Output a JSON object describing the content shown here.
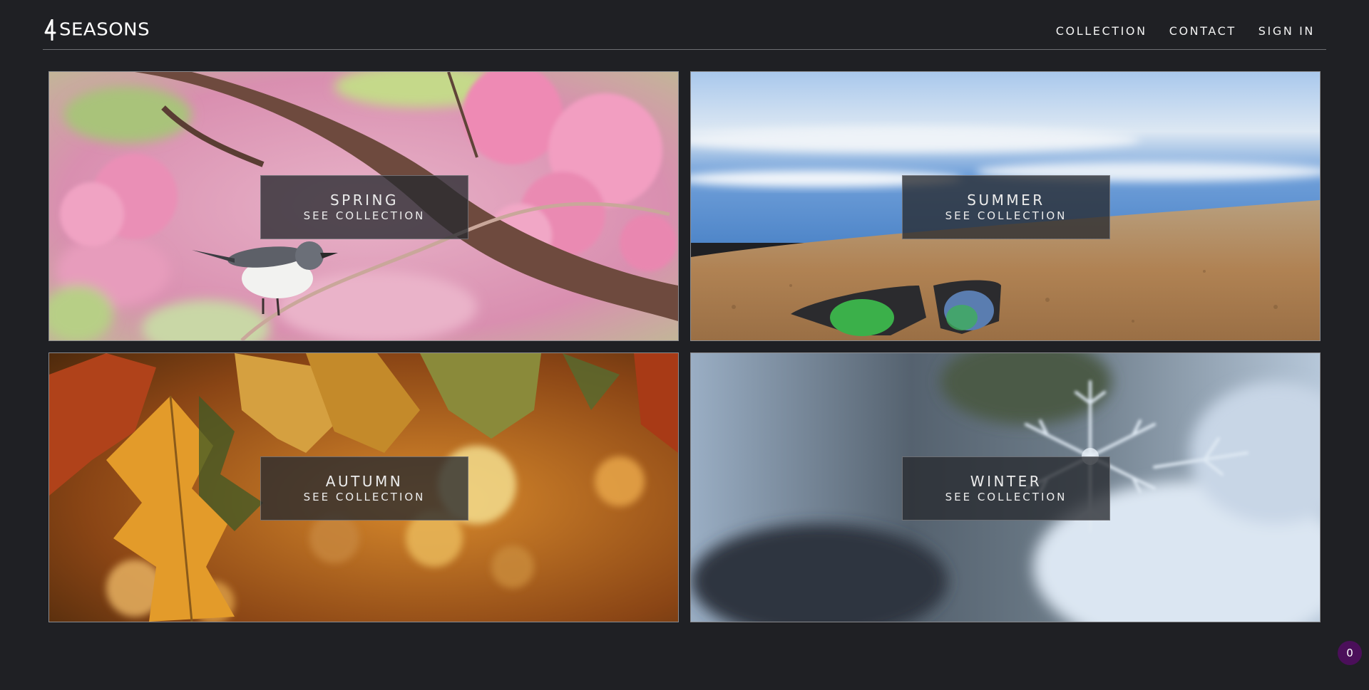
{
  "brand": {
    "logo_mark": "4",
    "logo_text": "SEASONS"
  },
  "nav": {
    "items": [
      "COLLECTION",
      "CONTACT",
      "SIGN IN"
    ]
  },
  "tiles": [
    {
      "season": "SPRING",
      "cta": "SEE COLLECTION",
      "image": "pink-blossom-bird-photo"
    },
    {
      "season": "SUMMER",
      "cta": "SEE COLLECTION",
      "image": "beach-sunglasses-photo"
    },
    {
      "season": "AUTUMN",
      "cta": "SEE COLLECTION",
      "image": "autumn-leaves-photo"
    },
    {
      "season": "WINTER",
      "cta": "SEE COLLECTION",
      "image": "snowflake-photo"
    }
  ],
  "badge": {
    "count": "0"
  },
  "colors": {
    "background": "#1f2024",
    "caption_bg": "#282a30",
    "badge": "#4b0f5a",
    "text": "#f2f2f2"
  }
}
